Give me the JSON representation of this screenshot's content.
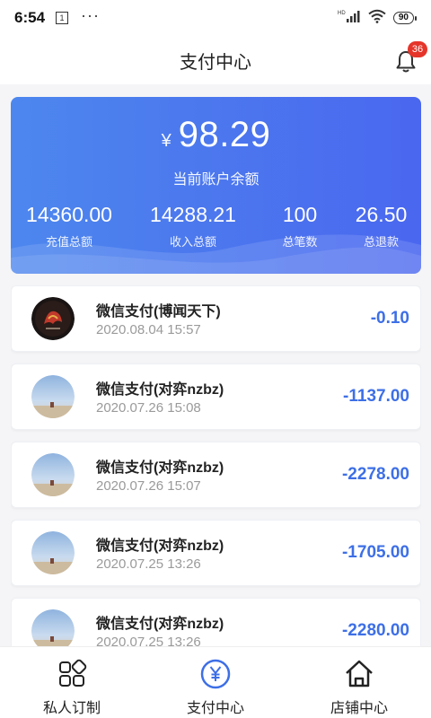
{
  "status_bar": {
    "time": "6:54",
    "sim_label": "1",
    "more": "···",
    "network_label": "HD",
    "battery": "90"
  },
  "header": {
    "title": "支付中心",
    "notification_count": "36"
  },
  "balance": {
    "currency": "¥",
    "amount": "98.29",
    "label": "当前账户余额"
  },
  "stats": [
    {
      "value": "14360.00",
      "label": "充值总额"
    },
    {
      "value": "14288.21",
      "label": "收入总额"
    },
    {
      "value": "100",
      "label": "总笔数"
    },
    {
      "value": "26.50",
      "label": "总退款"
    }
  ],
  "transactions": [
    {
      "title": "微信支付(博闻天下)",
      "time": "2020.08.04 15:57",
      "amount": "-0.10",
      "avatar": "dark-logo"
    },
    {
      "title": "微信支付(对弈nzbz)",
      "time": "2020.07.26 15:08",
      "amount": "-1137.00",
      "avatar": "beach-photo"
    },
    {
      "title": "微信支付(对弈nzbz)",
      "time": "2020.07.26 15:07",
      "amount": "-2278.00",
      "avatar": "beach-photo"
    },
    {
      "title": "微信支付(对弈nzbz)",
      "time": "2020.07.25 13:26",
      "amount": "-1705.00",
      "avatar": "beach-photo"
    },
    {
      "title": "微信支付(对弈nzbz)",
      "time": "2020.07.25 13:26",
      "amount": "-2280.00",
      "avatar": "beach-photo"
    }
  ],
  "bottom_nav": [
    {
      "label": "私人订制",
      "icon": "grid-icon",
      "active": false
    },
    {
      "label": "支付中心",
      "icon": "yen-circle-icon",
      "active": true
    },
    {
      "label": "店铺中心",
      "icon": "home-icon",
      "active": false
    }
  ],
  "colors": {
    "accent": "#3d6fe6",
    "card_gradient_start": "#4d87ee",
    "card_gradient_end": "#4a67ef",
    "badge": "#e5352a"
  }
}
